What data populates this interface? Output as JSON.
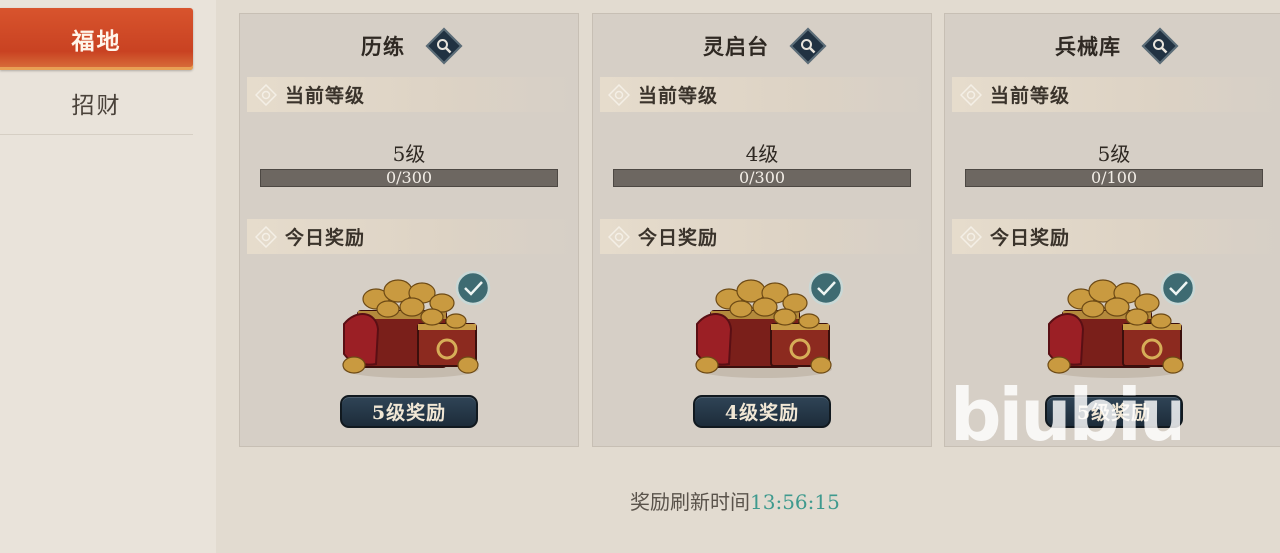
{
  "sidebar": {
    "tabs": [
      {
        "label": "福地",
        "active": true
      },
      {
        "label": "招财",
        "active": false
      }
    ]
  },
  "cards": [
    {
      "title": "历练",
      "current_level_label": "当前等级",
      "level": "5级",
      "progress_text": "0/300",
      "progress_fraction": 0,
      "today_reward_label": "今日奖励",
      "reward_claimed": true,
      "reward_button": "5级奖励"
    },
    {
      "title": "灵启台",
      "current_level_label": "当前等级",
      "level": "4级",
      "progress_text": "0/300",
      "progress_fraction": 0,
      "today_reward_label": "今日奖励",
      "reward_claimed": true,
      "reward_button": "4级奖励"
    },
    {
      "title": "兵械库",
      "current_level_label": "当前等级",
      "level": "5级",
      "progress_text": "0/100",
      "progress_fraction": 0,
      "today_reward_label": "今日奖励",
      "reward_claimed": true,
      "reward_button": "5级奖励"
    }
  ],
  "footer": {
    "refresh_label": "奖励刷新时间",
    "refresh_time": "13:56:15"
  },
  "watermark": {
    "text": "biubiu"
  },
  "colors": {
    "active_tab": "#d04a27",
    "timer": "#3f9a8e",
    "button": "#243545"
  }
}
